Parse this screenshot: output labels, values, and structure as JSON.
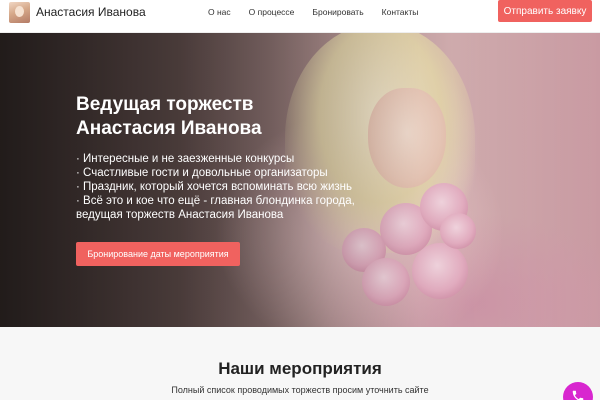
{
  "header": {
    "brand_name": "Анастасия Иванова",
    "nav": [
      "О нас",
      "О процессе",
      "Бронировать",
      "Контакты"
    ],
    "cta_label": "Отправить заявку"
  },
  "hero": {
    "title_line1": "Ведущая торжеств",
    "title_line2": "Анастасия Иванова",
    "bullets": [
      "· Интересные и не заезженные конкурсы",
      "· Счастливые гости и довольные организаторы",
      "· Праздник, который хочется вспоминать всю жизнь",
      "· Всё это и кое что ещё - главная блондинка города,",
      "ведущая торжеств Анастасия Иванова"
    ],
    "button_label": "Бронирование даты мероприятия"
  },
  "section": {
    "title": "Наши мероприятия",
    "subtitle": "Полный список проводимых торжеств просим уточнить сайте"
  },
  "colors": {
    "accent": "#f0625f",
    "phone_button": "#d826cf"
  },
  "icons": {
    "brand_avatar": "avatar-photo",
    "phone": "phone-icon"
  }
}
